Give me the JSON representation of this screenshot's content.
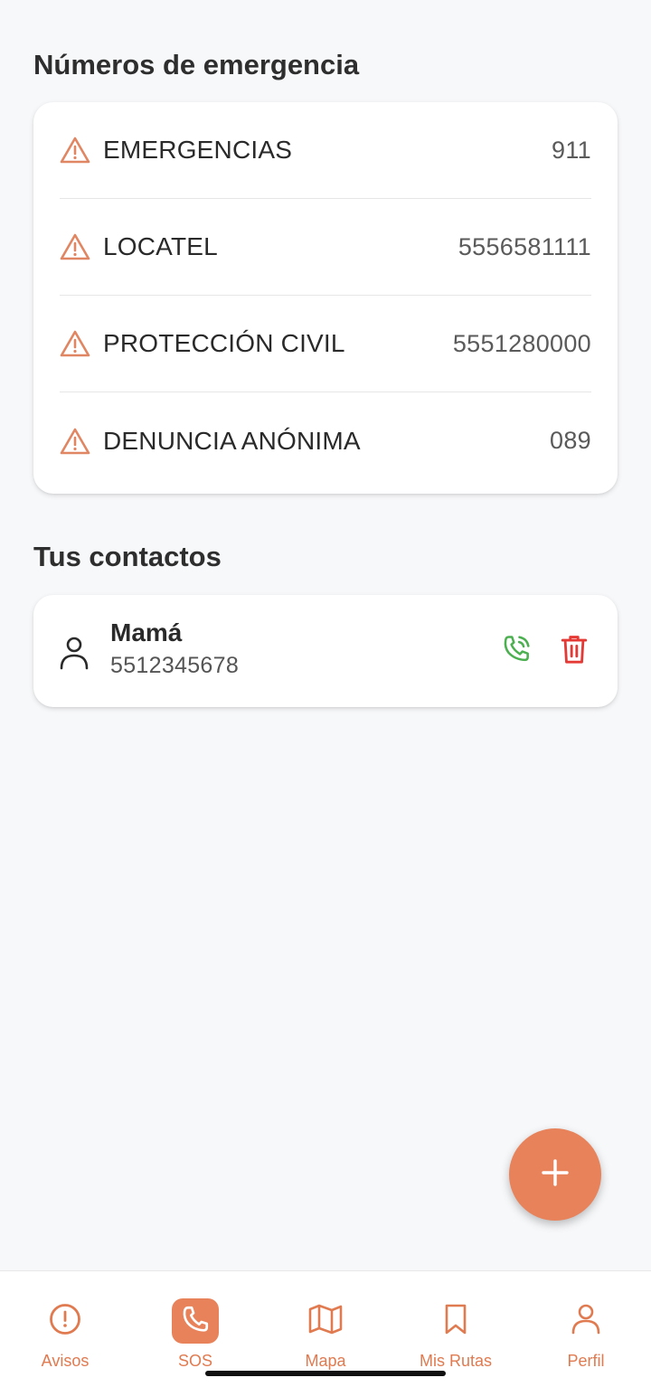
{
  "emergency": {
    "title": "Números de emergencia",
    "items": [
      {
        "name": "EMERGENCIAS",
        "number": "911"
      },
      {
        "name": "LOCATEL",
        "number": "5556581111"
      },
      {
        "name": "PROTECCIÓN CIVIL",
        "number": "5551280000"
      },
      {
        "name": "DENUNCIA ANÓNIMA",
        "number": "089"
      }
    ],
    "icon": "warning-triangle-icon"
  },
  "contacts": {
    "title": "Tus contactos",
    "items": [
      {
        "name": "Mamá",
        "phone": "5512345678"
      }
    ]
  },
  "fab": {
    "icon": "plus-icon"
  },
  "nav": {
    "items": [
      {
        "label": "Avisos",
        "icon": "alert-circle-icon"
      },
      {
        "label": "SOS",
        "icon": "phone-icon"
      },
      {
        "label": "Mapa",
        "icon": "map-icon"
      },
      {
        "label": "Mis Rutas",
        "icon": "bookmark-icon"
      },
      {
        "label": "Perfil",
        "icon": "user-icon"
      }
    ],
    "active": "SOS"
  },
  "colors": {
    "accent": "#e8825a",
    "call": "#4caf50",
    "delete": "#e53935",
    "background": "#f7f8fa"
  }
}
